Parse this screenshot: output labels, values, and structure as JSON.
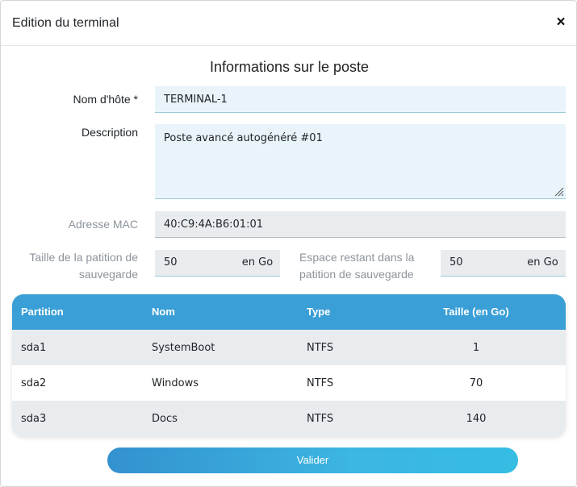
{
  "modal": {
    "title": "Edition du terminal",
    "close_glyph": "×"
  },
  "section": {
    "title": "Informations sur le poste"
  },
  "form": {
    "hostname": {
      "label": "Nom d'hôte *",
      "value": "TERMINAL-1"
    },
    "description": {
      "label": "Description",
      "value": "Poste avancé autogénéré #01"
    },
    "mac": {
      "label": "Adresse MAC",
      "value": "40:C9:4A:B6:01:01"
    },
    "backup_size": {
      "label_line1": "Taille de la patition de",
      "label_line2": "sauvegarde",
      "value": "50",
      "unit": "en Go"
    },
    "remaining": {
      "label_line1": "Espace restant dans la",
      "label_line2": "patition de sauvegarde",
      "value": "50",
      "unit": "en Go"
    }
  },
  "table": {
    "headers": [
      "Partition",
      "Nom",
      "Type",
      "Taille (en Go)"
    ],
    "rows": [
      [
        "sda1",
        "SystemBoot",
        "NTFS",
        "1"
      ],
      [
        "sda2",
        "Windows",
        "NTFS",
        "70"
      ],
      [
        "sda3",
        "Docs",
        "NTFS",
        "140"
      ]
    ]
  },
  "submit": {
    "label": "Valider"
  },
  "colors": {
    "header_blue": "#3a9fd6",
    "field_bg": "#e9f4fa",
    "readonly_bg": "#e9ecef",
    "button_start": "#3391cf",
    "button_end": "#35bde3"
  },
  "icons": {
    "close": "close-icon",
    "resize": "resize-grip-icon"
  }
}
